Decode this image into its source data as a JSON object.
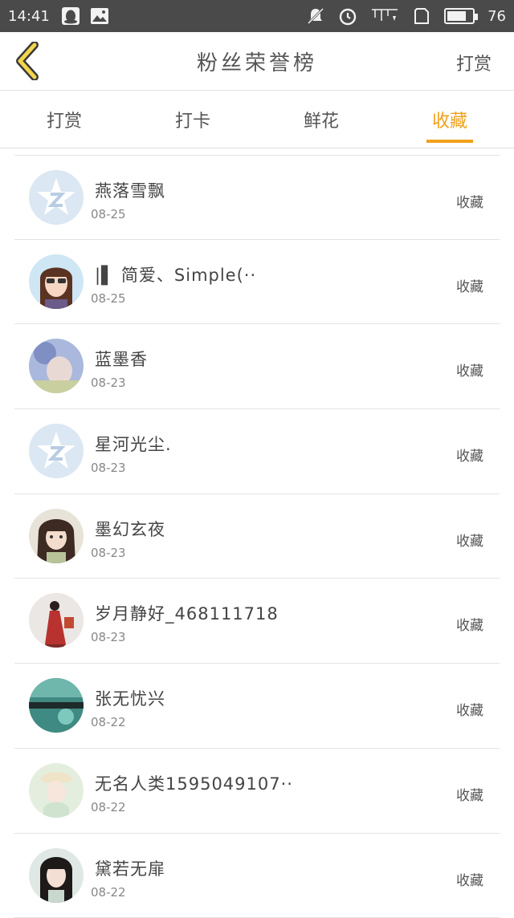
{
  "status_bar": {
    "time": "14:41",
    "battery_percent": "76",
    "battery_level": 0.76,
    "icons": [
      "qq-penguin-icon",
      "image-icon",
      "mute-icon",
      "alarm-icon",
      "signal-icon",
      "sim-icon",
      "battery-icon"
    ]
  },
  "header": {
    "back_icon": "chevron-left-icon",
    "title": "粉丝荣誉榜",
    "right_action": "打赏"
  },
  "tabs": [
    {
      "label": "打赏",
      "active": false
    },
    {
      "label": "打卡",
      "active": false
    },
    {
      "label": "鲜花",
      "active": false
    },
    {
      "label": "收藏",
      "active": true
    }
  ],
  "colors": {
    "accent": "#f0a11c",
    "status_bar_bg": "#4a4a4a",
    "text": "#444444",
    "divider": "#e3e3e3"
  },
  "list": [
    {
      "name": "燕落雪飘",
      "date": "08-25",
      "action": "收藏",
      "avatar": "default-qq-avatar"
    },
    {
      "name": "|▌ 简爱、Simple(··",
      "date": "08-25",
      "action": "收藏",
      "avatar": "girl-sunglasses-avatar"
    },
    {
      "name": "蓝墨香",
      "date": "08-23",
      "action": "收藏",
      "avatar": "blue-photo-avatar"
    },
    {
      "name": "星河光尘.",
      "date": "08-23",
      "action": "收藏",
      "avatar": "default-qq-avatar"
    },
    {
      "name": "墨幻玄夜",
      "date": "08-23",
      "action": "收藏",
      "avatar": "anime-girl-avatar"
    },
    {
      "name": "岁月静好_468111718",
      "date": "08-23",
      "action": "收藏",
      "avatar": "red-robe-figure-avatar"
    },
    {
      "name": "张无忧兴",
      "date": "08-22",
      "action": "收藏",
      "avatar": "teal-landscape-avatar"
    },
    {
      "name": "无名人类1595049107··",
      "date": "08-22",
      "action": "收藏",
      "avatar": "pale-girl-avatar"
    },
    {
      "name": "黛若无扉",
      "date": "08-22",
      "action": "收藏",
      "avatar": "dark-hair-girl-avatar"
    }
  ]
}
